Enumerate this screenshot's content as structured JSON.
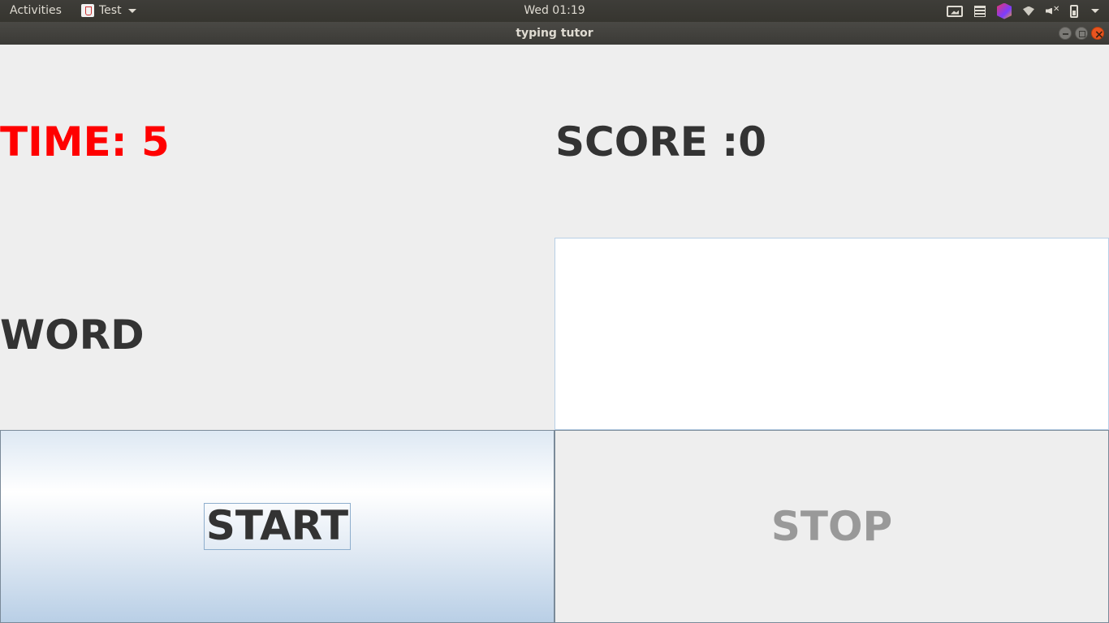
{
  "topbar": {
    "activities_label": "Activities",
    "app_name": "Test",
    "clock": "Wed 01:19",
    "tray_icons": [
      "screenshot-icon",
      "notes-icon",
      "jetbrains-toolbox-icon",
      "wifi-icon",
      "volume-muted-icon",
      "battery-icon",
      "system-menu-caret-icon"
    ]
  },
  "window": {
    "title": "typing tutor"
  },
  "app": {
    "time_label": "TIME: 5",
    "score_label": "SCORE :0",
    "word_label": "WORD",
    "word_input_value": "",
    "start_label": "START",
    "stop_label": "STOP",
    "colors": {
      "time": "#ff0000",
      "text": "#333333",
      "stop_disabled": "#999999"
    }
  }
}
